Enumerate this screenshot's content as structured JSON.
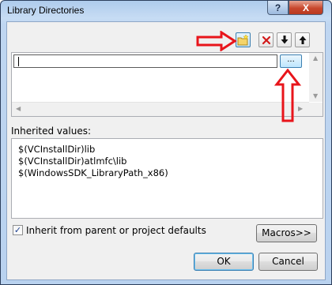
{
  "window": {
    "title": "Library Directories",
    "help_label": "?",
    "close_label": "X"
  },
  "toolbar": {
    "new_line_icon": "new-folder-icon",
    "delete_icon": "delete-icon",
    "move_down_icon": "arrow-down-icon",
    "move_up_icon": "arrow-up-icon"
  },
  "entry": {
    "value": "",
    "browse_label": "..."
  },
  "inherited": {
    "label": "Inherited values:",
    "values": [
      "$(VCInstallDir)lib",
      "$(VCInstallDir)atlmfc\\lib",
      "$(WindowsSDK_LibraryPath_x86)"
    ]
  },
  "inherit_checkbox": {
    "label": "Inherit from parent or project defaults",
    "checked": true
  },
  "buttons": {
    "macros": "Macros>>",
    "ok": "OK",
    "cancel": "Cancel"
  },
  "colors": {
    "annotation_arrow": "#e8151b",
    "title_gradient": "#aecbec"
  }
}
